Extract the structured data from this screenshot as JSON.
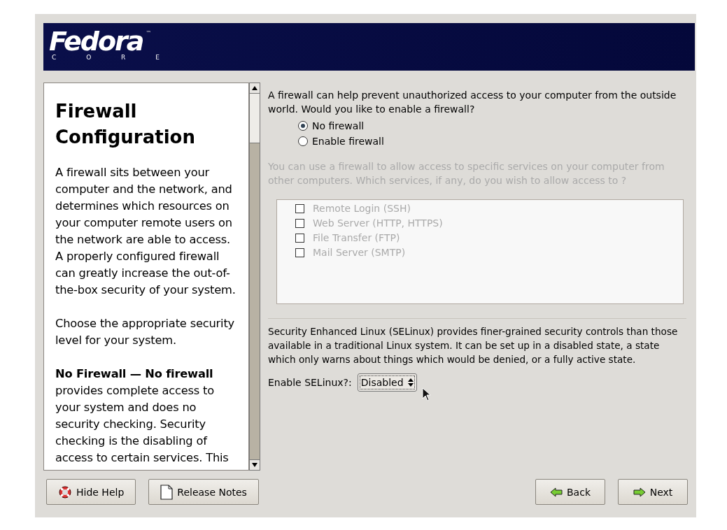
{
  "header": {
    "logo": "Fedora",
    "trademark": "™",
    "subtitle": "C O R E"
  },
  "help": {
    "title": "Firewall Configuration",
    "paragraphs": [
      "A firewall sits between your computer and the network, and determines which resources on your computer remote users on the network are able to access. A properly configured firewall can greatly increase the out-of-the-box security of your system.",
      "Choose the appropriate security level for your system.",
      "**No Firewall — No firewall** provides complete access to your system and does no security checking. Security checking is the disabling of access to certain services. This"
    ]
  },
  "firewall": {
    "question": "A firewall can help prevent unauthorized access to your computer from the outside world.  Would you like to enable a firewall?",
    "options": [
      {
        "label": "No firewall",
        "selected": true
      },
      {
        "label": "Enable firewall",
        "selected": false
      }
    ],
    "services_prompt": "You can use a firewall to allow access to specific services on your computer from other computers. Which services, if any, do you wish to allow access to ?",
    "services_disabled": true,
    "services": [
      {
        "label": "Remote Login (SSH)",
        "checked": false
      },
      {
        "label": "Web Server (HTTP, HTTPS)",
        "checked": false
      },
      {
        "label": "File Transfer (FTP)",
        "checked": false
      },
      {
        "label": "Mail Server (SMTP)",
        "checked": false
      }
    ]
  },
  "selinux": {
    "description": "Security Enhanced Linux (SELinux) provides finer-grained security controls than those available in a traditional Linux system.  It can be set up in a disabled state, a state which only warns about things which would be denied, or a fully active state.",
    "label": "Enable SELinux?:",
    "value": "Disabled"
  },
  "buttons": [
    {
      "label": "Hide Help",
      "kind": "help"
    },
    {
      "label": "Release Notes",
      "kind": "notes"
    },
    {
      "label": "Back",
      "kind": "back"
    },
    {
      "label": "Next",
      "kind": "next"
    }
  ]
}
